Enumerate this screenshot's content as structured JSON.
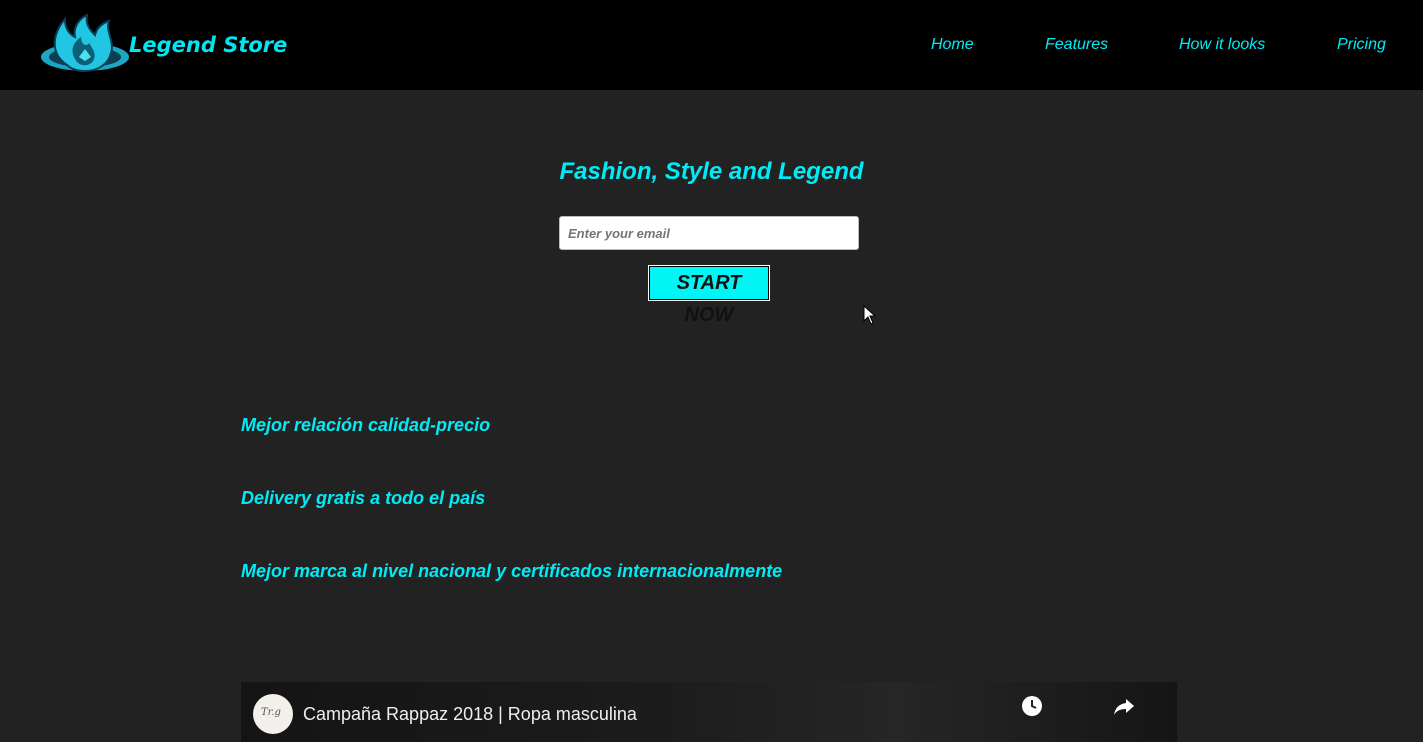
{
  "header": {
    "logo_text": "Legend Store",
    "nav": [
      {
        "label": "Home"
      },
      {
        "label": "Features"
      },
      {
        "label": "How it looks"
      },
      {
        "label": "Pricing"
      }
    ]
  },
  "hero": {
    "title": "Fashion, Style and Legend",
    "email_placeholder": "Enter your email",
    "start_label": "START NOW"
  },
  "features": [
    {
      "text": "Mejor relación calidad-precio"
    },
    {
      "text": "Delivery gratis a todo el país"
    },
    {
      "text": "Mejor marca al nivel nacional y certificados internacionalmente"
    }
  ],
  "video": {
    "title": "Campaña Rappaz 2018 | Ropa masculina",
    "watch_later_icon": "clock-icon",
    "share_icon": "share-icon"
  },
  "colors": {
    "accent": "#00ecf5",
    "header_bg": "#000000",
    "page_bg": "#222222",
    "button_bg": "#00f5f5"
  }
}
